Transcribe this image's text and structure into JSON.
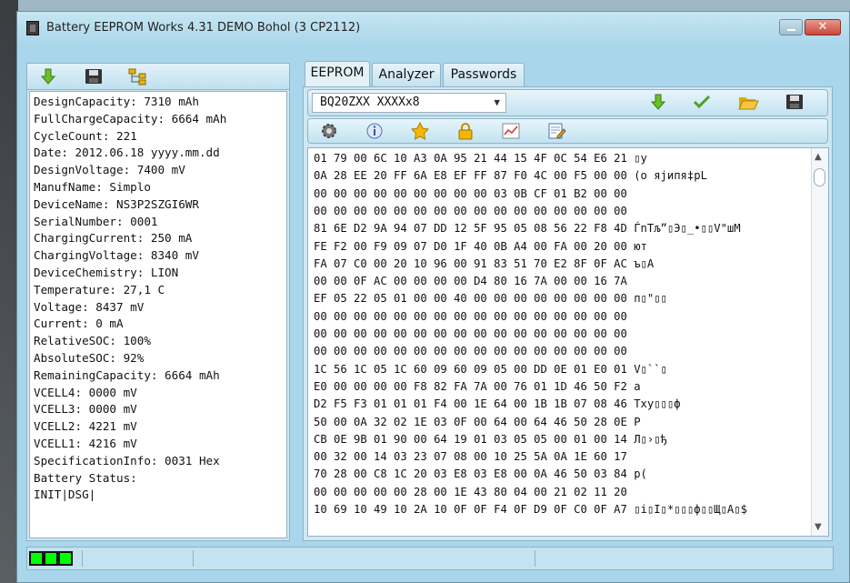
{
  "window": {
    "title": "Battery EEPROM Works  4.31 DEMO Bohol (3 CP2112)",
    "close_label": "✕"
  },
  "left_toolbar": {
    "icons": [
      "download-arrow-icon",
      "save-icon",
      "tree-icon"
    ]
  },
  "info_lines": [
    "DesignCapacity: 7310 mAh",
    "FullChargeCapacity: 6664 mAh",
    "CycleCount: 221",
    "Date: 2012.06.18 yyyy.mm.dd",
    "DesignVoltage: 7400 mV",
    "ManufName: Simplo",
    "DeviceName: NS3P2SZGI6WR",
    "SerialNumber: 0001",
    "ChargingCurrent: 250 mA",
    "ChargingVoltage: 8340 mV",
    "DeviceChemistry: LION",
    "Temperature: 27,1 C",
    "Voltage: 8437 mV",
    "Current: 0 mA",
    "RelativeSOC: 100%",
    "AbsoluteSOC: 92%",
    "RemainingCapacity: 6664 mAh",
    "VCELL4: 0000 mV",
    "VCELL3: 0000 mV",
    "VCELL2: 4221 mV",
    "VCELL1: 4216 mV",
    "SpecificationInfo: 0031 Hex",
    "Battery Status:",
    "INIT|DSG|"
  ],
  "tabs": [
    {
      "label": "EEPROM",
      "active": true
    },
    {
      "label": "Analyzer",
      "active": false
    },
    {
      "label": "Passwords",
      "active": false
    }
  ],
  "chip_select": {
    "value": "BQ20ZXX    XXXXx8",
    "arrow": "▼"
  },
  "toolbar1_icons": [
    "download-arrow-icon",
    "checkmark-icon",
    "open-folder-icon",
    "save-icon"
  ],
  "toolbar2_icons": [
    "gear-icon",
    "info-icon",
    "star-icon",
    "lock-icon",
    "chart-icon",
    "edit-document-icon"
  ],
  "hex_rows": [
    "01 79 00 6C 10 A3 0A 95 21 44 15 4F 0C 54 E6 21 ▯y",
    "0A 28 EE 20 FF 6A E8 EF FF 87 F0 4C 00 F5 00 00 (о яјипя‡рL",
    "00 00 00 00 00 00 00 00 00 03 0B CF 01 B2 00 00",
    "00 00 00 00 00 00 00 00 00 00 00 00 00 00 00 00",
    "81 6E D2 9A 94 07 DD 12 5F 95 05 08 56 22 F8 4D ЃnТљ”▯Э▯_•▯▯V\"шМ",
    "FE F2 00 F9 09 07 D0 1F 40 0B A4 00 FA 00 20 00 ют",
    "FA 07 C0 00 20 10 96 00 91 83 51 70 E2 8F 0F AC ъ▯А",
    "00 00 0F AC 00 00 00 00 D4 80 16 7A 00 00 16 7A",
    "EF 05 22 05 01 00 00 40 00 00 00 00 00 00 00 00 п▯\"▯▯",
    "00 00 00 00 00 00 00 00 00 00 00 00 00 00 00 00",
    "00 00 00 00 00 00 00 00 00 00 00 00 00 00 00 00",
    "00 00 00 00 00 00 00 00 00 00 00 00 00 00 00 00",
    "1C 56 1C 05 1C 60 09 60 09 05 00 DD 0E 01 E0 01 V▯``▯",
    "E0 00 00 00 00 F8 82 FA 7A 00 76 01 1D 46 50 F2 а",
    "D2 F5 F3 01 01 01 F4 00 1E 64 00 1B 1B 07 08 46 Тху▯▯▯ф",
    "50 00 0A 32 02 1E 03 0F 00 64 00 64 46 50 28 0E P",
    "CB 0E 9B 01 90 00 64 19 01 03 05 05 00 01 00 14 Л▯›▯ђ",
    "00 32 00 14 03 23 07 08 00 10 25 5A 0A 1E 60 17",
    "70 28 00 C8 1C 20 03 E8 03 E8 00 0A 46 50 03 84 p(",
    "00 00 00 00 00 28 00 1E 43 80 04 00 21 02 11 20",
    "10 69 10 49 10 2A 10 0F 0F F4 0F D9 0F C0 0F A7 ▯i▯I▯*▯▯▯ф▯▯Щ▯А▯$"
  ],
  "scrollbar": {
    "up": "▲",
    "down": "▼"
  },
  "status_leds": 3
}
